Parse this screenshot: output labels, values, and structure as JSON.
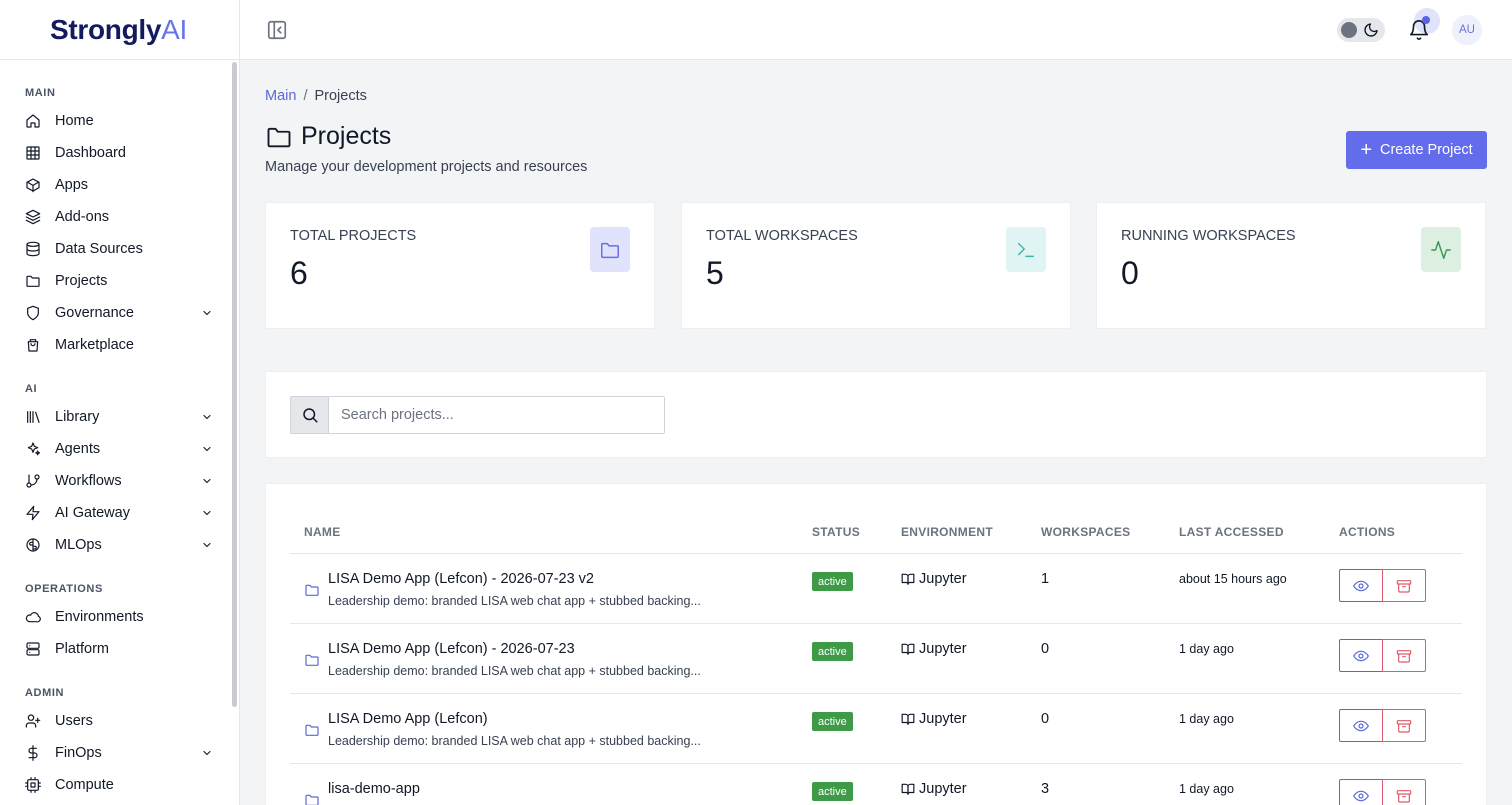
{
  "brand": {
    "name": "Strongly",
    "suffix": "AI"
  },
  "sidebar": {
    "sections": [
      {
        "title": "MAIN",
        "items": [
          {
            "label": "Home",
            "icon": "home-icon"
          },
          {
            "label": "Dashboard",
            "icon": "grid-icon"
          },
          {
            "label": "Apps",
            "icon": "box-icon"
          },
          {
            "label": "Add-ons",
            "icon": "layers-icon"
          },
          {
            "label": "Data Sources",
            "icon": "database-icon"
          },
          {
            "label": "Projects",
            "icon": "folder-icon"
          },
          {
            "label": "Governance",
            "icon": "shield-icon",
            "expandable": true
          },
          {
            "label": "Marketplace",
            "icon": "shopping-bag-icon"
          }
        ]
      },
      {
        "title": "AI",
        "items": [
          {
            "label": "Library",
            "icon": "library-icon",
            "expandable": true
          },
          {
            "label": "Agents",
            "icon": "sparkles-icon",
            "expandable": true
          },
          {
            "label": "Workflows",
            "icon": "git-branch-icon",
            "expandable": true
          },
          {
            "label": "AI Gateway",
            "icon": "zap-icon",
            "expandable": true
          },
          {
            "label": "MLOps",
            "icon": "brain-icon",
            "expandable": true
          }
        ]
      },
      {
        "title": "OPERATIONS",
        "items": [
          {
            "label": "Environments",
            "icon": "cloud-icon"
          },
          {
            "label": "Platform",
            "icon": "server-icon"
          }
        ]
      },
      {
        "title": "ADMIN",
        "items": [
          {
            "label": "Users",
            "icon": "user-plus-icon"
          },
          {
            "label": "FinOps",
            "icon": "dollar-icon",
            "expandable": true
          },
          {
            "label": "Compute",
            "icon": "cpu-icon"
          }
        ]
      }
    ]
  },
  "topbar": {
    "avatar_initials": "AU"
  },
  "breadcrumb": {
    "root": "Main",
    "separator": "/",
    "current": "Projects"
  },
  "page": {
    "title": "Projects",
    "subtitle": "Manage your development projects and resources",
    "create_button": "Create Project"
  },
  "stats": [
    {
      "label": "TOTAL PROJECTS",
      "value": "6",
      "icon": "folder-icon",
      "icon_bg": "#e0e3fb",
      "icon_color": "#6470e6"
    },
    {
      "label": "TOTAL WORKSPACES",
      "value": "5",
      "icon": "terminal-icon",
      "icon_bg": "#e0f5f3",
      "icon_color": "#3cb7a8"
    },
    {
      "label": "RUNNING WORKSPACES",
      "value": "0",
      "icon": "activity-icon",
      "icon_bg": "#dcefe1",
      "icon_color": "#3a9a50"
    }
  ],
  "search": {
    "placeholder": "Search projects..."
  },
  "table": {
    "columns": [
      "NAME",
      "STATUS",
      "ENVIRONMENT",
      "WORKSPACES",
      "LAST ACCESSED",
      "ACTIONS"
    ],
    "rows": [
      {
        "name": "LISA Demo App (Lefcon) - 2026-07-23 v2",
        "description": "Leadership demo: branded LISA web chat app + stubbed backing...",
        "status": "active",
        "environment": "Jupyter",
        "workspaces": "1",
        "last_accessed": "about 15 hours ago"
      },
      {
        "name": "LISA Demo App (Lefcon) - 2026-07-23",
        "description": "Leadership demo: branded LISA web chat app + stubbed backing...",
        "status": "active",
        "environment": "Jupyter",
        "workspaces": "0",
        "last_accessed": "1 day ago"
      },
      {
        "name": "LISA Demo App (Lefcon)",
        "description": "Leadership demo: branded LISA web chat app + stubbed backing...",
        "status": "active",
        "environment": "Jupyter",
        "workspaces": "0",
        "last_accessed": "1 day ago"
      },
      {
        "name": "lisa-demo-app",
        "description": "",
        "status": "active",
        "environment": "Jupyter",
        "workspaces": "3",
        "last_accessed": "1 day ago"
      }
    ]
  },
  "colors": {
    "accent": "#636ceb",
    "danger": "#e05b6a",
    "success": "#3f9a48"
  }
}
